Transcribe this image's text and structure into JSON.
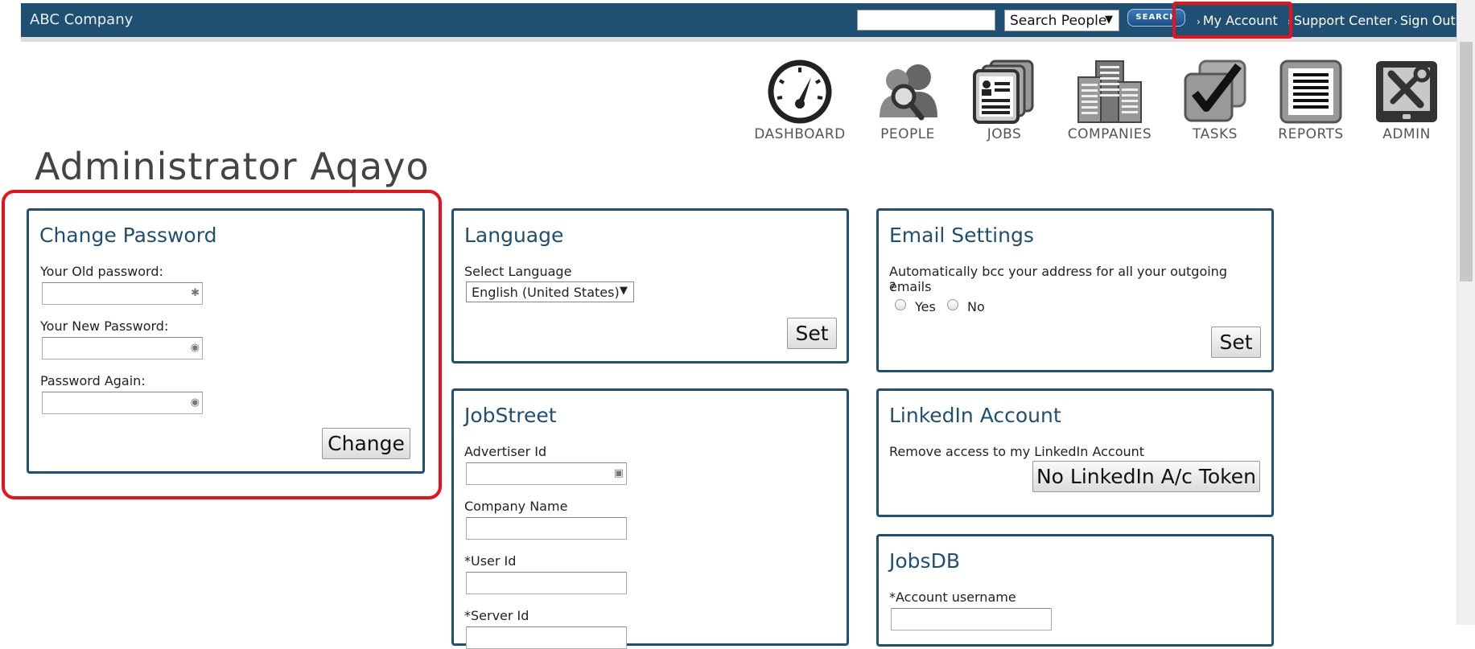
{
  "header": {
    "brand": "ABC Company",
    "search_select": "Search People",
    "search_button": "SEARCH",
    "links": [
      "My Account",
      "Support Center",
      "Sign Out"
    ]
  },
  "nav": [
    {
      "label": "DASHBOARD",
      "icon": "dashboard-icon"
    },
    {
      "label": "PEOPLE",
      "icon": "people-icon"
    },
    {
      "label": "JOBS",
      "icon": "jobs-icon"
    },
    {
      "label": "COMPANIES",
      "icon": "companies-icon"
    },
    {
      "label": "TASKS",
      "icon": "tasks-icon"
    },
    {
      "label": "REPORTS",
      "icon": "reports-icon"
    },
    {
      "label": "ADMIN",
      "icon": "admin-icon"
    }
  ],
  "page": {
    "title": "Administrator Aqayo"
  },
  "change_password": {
    "title": "Change Password",
    "old_label": "Your Old password:",
    "new_label": "Your New Password:",
    "again_label": "Password Again:",
    "button": "Change"
  },
  "language": {
    "title": "Language",
    "select_label": "Select Language",
    "selected": "English (United States)",
    "button": "Set"
  },
  "email_settings": {
    "title": "Email Settings",
    "question": "Automatically bcc your address for all your outgoing emails",
    "question_end": "?",
    "yes": "Yes",
    "no": "No",
    "button": "Set"
  },
  "jobstreet": {
    "title": "JobStreet",
    "advertiser_label": "Advertiser Id",
    "company_label": "Company Name",
    "user_label": "*User Id",
    "server_label": "*Server Id"
  },
  "linkedin": {
    "title": "LinkedIn Account",
    "text": "Remove access to my LinkedIn Account",
    "button": "No LinkedIn A/c Token"
  },
  "jobsdb": {
    "title": "JobsDB",
    "username_label": "*Account username"
  }
}
